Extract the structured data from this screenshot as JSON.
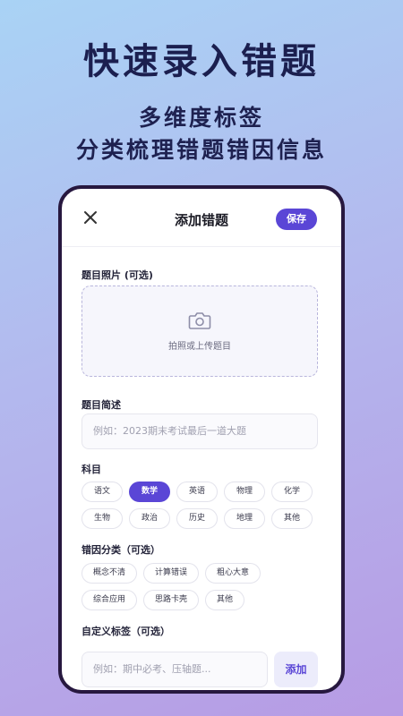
{
  "hero": {
    "title": "快速录入错题",
    "subtitle_line1": "多维度标签",
    "subtitle_line2": "分类梳理错题错因信息"
  },
  "topbar": {
    "close_icon": "close-icon",
    "title": "添加错题",
    "save_label": "保存"
  },
  "photo": {
    "label": "题目照片 (可选)",
    "upload_text": "拍照或上传题目",
    "icon": "camera-icon"
  },
  "description": {
    "label": "题目简述",
    "placeholder": "例如：2023期末考试最后一道大题"
  },
  "subject": {
    "label": "科目",
    "rows": [
      [
        "语文",
        "数学",
        "英语",
        "物理",
        "化学"
      ],
      [
        "生物",
        "政治",
        "历史",
        "地理",
        "其他"
      ]
    ],
    "selected": "数学"
  },
  "error_cause": {
    "label": "错因分类（可选）",
    "rows": [
      [
        "概念不清",
        "计算错误",
        "粗心大意"
      ],
      [
        "综合应用",
        "思路卡壳",
        "其他"
      ]
    ]
  },
  "custom_tag": {
    "label": "自定义标签（可选）",
    "placeholder": "例如：期中必考、压轴题...",
    "add_label": "添加"
  },
  "colors": {
    "accent": "#5a46d6",
    "frame": "#27183f",
    "hero_text": "#1b1f4f"
  }
}
